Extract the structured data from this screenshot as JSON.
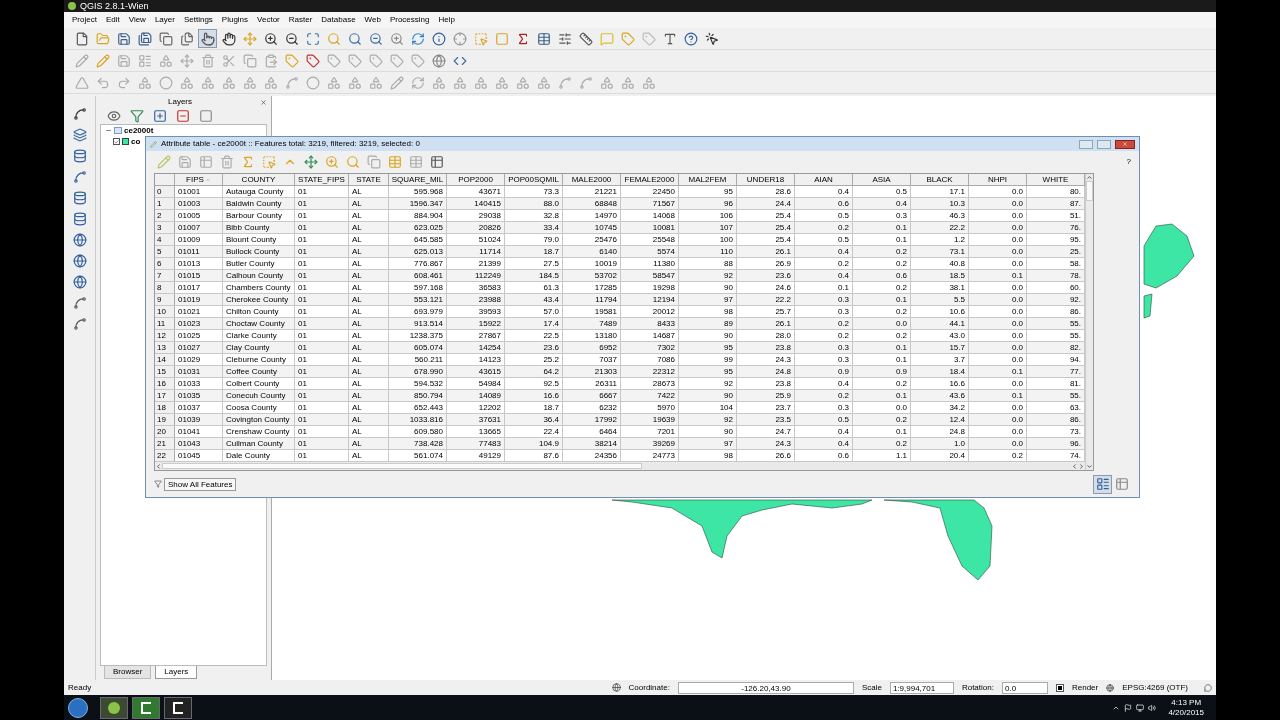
{
  "window": {
    "title": "QGIS 2.8.1-Wien"
  },
  "menu": [
    "Project",
    "Edit",
    "View",
    "Layer",
    "Settings",
    "Plugins",
    "Vector",
    "Raster",
    "Database",
    "Web",
    "Processing",
    "Help"
  ],
  "layers_panel": {
    "title": "Layers",
    "tree": [
      {
        "label": "ce2000t",
        "expanded": true,
        "children": [
          {
            "label": "co",
            "checked": true
          }
        ]
      }
    ],
    "tabs": [
      {
        "label": "Browser",
        "selected": false
      },
      {
        "label": "Layers",
        "selected": true
      }
    ]
  },
  "attribute_table": {
    "title": "Attribute table - ce2000t :: Features total: 3219, filtered: 3219, selected: 0",
    "help": "?",
    "columns": [
      {
        "name": "FIPS",
        "sorted": true
      },
      {
        "name": "COUNTY",
        "sorted": false
      },
      {
        "name": "STATE_FIPS",
        "sorted": false
      },
      {
        "name": "STATE",
        "sorted": false
      },
      {
        "name": "SQUARE_MIL",
        "sorted": false
      },
      {
        "name": "POP2000",
        "sorted": false
      },
      {
        "name": "POP00SQMIL",
        "sorted": false
      },
      {
        "name": "MALE2000",
        "sorted": false
      },
      {
        "name": "FEMALE2000",
        "sorted": false
      },
      {
        "name": "MAL2FEM",
        "sorted": false
      },
      {
        "name": "UNDER18",
        "sorted": false
      },
      {
        "name": "AIAN",
        "sorted": false
      },
      {
        "name": "ASIA",
        "sorted": false
      },
      {
        "name": "BLACK",
        "sorted": false
      },
      {
        "name": "NHPI",
        "sorted": false
      },
      {
        "name": "WHITE",
        "sorted": false
      }
    ],
    "rows": [
      {
        "index": "0",
        "cells": [
          "01001",
          "Autauga County",
          "01",
          "AL",
          "595.968",
          "43671",
          "73.3",
          "21221",
          "22450",
          "95",
          "28.6",
          "0.4",
          "0.5",
          "17.1",
          "0.0",
          "80."
        ]
      },
      {
        "index": "1",
        "cells": [
          "01003",
          "Baldwin County",
          "01",
          "AL",
          "1596.347",
          "140415",
          "88.0",
          "68848",
          "71567",
          "96",
          "24.4",
          "0.6",
          "0.4",
          "10.3",
          "0.0",
          "87."
        ]
      },
      {
        "index": "2",
        "cells": [
          "01005",
          "Barbour County",
          "01",
          "AL",
          "884.904",
          "29038",
          "32.8",
          "14970",
          "14068",
          "106",
          "25.4",
          "0.5",
          "0.3",
          "46.3",
          "0.0",
          "51."
        ]
      },
      {
        "index": "3",
        "cells": [
          "01007",
          "Bibb County",
          "01",
          "AL",
          "623.025",
          "20826",
          "33.4",
          "10745",
          "10081",
          "107",
          "25.4",
          "0.2",
          "0.1",
          "22.2",
          "0.0",
          "76."
        ]
      },
      {
        "index": "4",
        "cells": [
          "01009",
          "Blount County",
          "01",
          "AL",
          "645.585",
          "51024",
          "79.0",
          "25476",
          "25548",
          "100",
          "25.4",
          "0.5",
          "0.1",
          "1.2",
          "0.0",
          "95."
        ]
      },
      {
        "index": "5",
        "cells": [
          "01011",
          "Bullock County",
          "01",
          "AL",
          "625.013",
          "11714",
          "18.7",
          "6140",
          "5574",
          "110",
          "26.1",
          "0.4",
          "0.2",
          "73.1",
          "0.0",
          "25."
        ]
      },
      {
        "index": "6",
        "cells": [
          "01013",
          "Butler County",
          "01",
          "AL",
          "776.867",
          "21399",
          "27.5",
          "10019",
          "11380",
          "88",
          "26.9",
          "0.2",
          "0.2",
          "40.8",
          "0.0",
          "58."
        ]
      },
      {
        "index": "7",
        "cells": [
          "01015",
          "Calhoun County",
          "01",
          "AL",
          "608.461",
          "112249",
          "184.5",
          "53702",
          "58547",
          "92",
          "23.6",
          "0.4",
          "0.6",
          "18.5",
          "0.1",
          "78."
        ]
      },
      {
        "index": "8",
        "cells": [
          "01017",
          "Chambers County",
          "01",
          "AL",
          "597.168",
          "36583",
          "61.3",
          "17285",
          "19298",
          "90",
          "24.6",
          "0.1",
          "0.2",
          "38.1",
          "0.0",
          "60."
        ]
      },
      {
        "index": "9",
        "cells": [
          "01019",
          "Cherokee County",
          "01",
          "AL",
          "553.121",
          "23988",
          "43.4",
          "11794",
          "12194",
          "97",
          "22.2",
          "0.3",
          "0.1",
          "5.5",
          "0.0",
          "92."
        ]
      },
      {
        "index": "10",
        "cells": [
          "01021",
          "Chilton County",
          "01",
          "AL",
          "693.979",
          "39593",
          "57.0",
          "19581",
          "20012",
          "98",
          "25.7",
          "0.3",
          "0.2",
          "10.6",
          "0.0",
          "86."
        ]
      },
      {
        "index": "11",
        "cells": [
          "01023",
          "Choctaw County",
          "01",
          "AL",
          "913.514",
          "15922",
          "17.4",
          "7489",
          "8433",
          "89",
          "26.1",
          "0.2",
          "0.0",
          "44.1",
          "0.0",
          "55."
        ]
      },
      {
        "index": "12",
        "cells": [
          "01025",
          "Clarke County",
          "01",
          "AL",
          "1238.375",
          "27867",
          "22.5",
          "13180",
          "14687",
          "90",
          "28.0",
          "0.2",
          "0.2",
          "43.0",
          "0.0",
          "55."
        ]
      },
      {
        "index": "13",
        "cells": [
          "01027",
          "Clay County",
          "01",
          "AL",
          "605.074",
          "14254",
          "23.6",
          "6952",
          "7302",
          "95",
          "23.8",
          "0.3",
          "0.1",
          "15.7",
          "0.0",
          "82."
        ]
      },
      {
        "index": "14",
        "cells": [
          "01029",
          "Cleburne County",
          "01",
          "AL",
          "560.211",
          "14123",
          "25.2",
          "7037",
          "7086",
          "99",
          "24.3",
          "0.3",
          "0.1",
          "3.7",
          "0.0",
          "94."
        ]
      },
      {
        "index": "15",
        "cells": [
          "01031",
          "Coffee County",
          "01",
          "AL",
          "678.990",
          "43615",
          "64.2",
          "21303",
          "22312",
          "95",
          "24.8",
          "0.9",
          "0.9",
          "18.4",
          "0.1",
          "77."
        ]
      },
      {
        "index": "16",
        "cells": [
          "01033",
          "Colbert County",
          "01",
          "AL",
          "594.532",
          "54984",
          "92.5",
          "26311",
          "28673",
          "92",
          "23.8",
          "0.4",
          "0.2",
          "16.6",
          "0.0",
          "81."
        ]
      },
      {
        "index": "17",
        "cells": [
          "01035",
          "Conecuh County",
          "01",
          "AL",
          "850.794",
          "14089",
          "16.6",
          "6667",
          "7422",
          "90",
          "25.9",
          "0.2",
          "0.1",
          "43.6",
          "0.1",
          "55."
        ]
      },
      {
        "index": "18",
        "cells": [
          "01037",
          "Coosa County",
          "01",
          "AL",
          "652.443",
          "12202",
          "18.7",
          "6232",
          "5970",
          "104",
          "23.7",
          "0.3",
          "0.0",
          "34.2",
          "0.0",
          "63."
        ]
      },
      {
        "index": "19",
        "cells": [
          "01039",
          "Covington County",
          "01",
          "AL",
          "1033.816",
          "37631",
          "36.4",
          "17992",
          "19639",
          "92",
          "23.5",
          "0.5",
          "0.2",
          "12.4",
          "0.0",
          "86."
        ]
      },
      {
        "index": "20",
        "cells": [
          "01041",
          "Crenshaw County",
          "01",
          "AL",
          "609.580",
          "13665",
          "22.4",
          "6464",
          "7201",
          "90",
          "24.7",
          "0.4",
          "0.1",
          "24.8",
          "0.0",
          "73."
        ]
      },
      {
        "index": "21",
        "cells": [
          "01043",
          "Cullman County",
          "01",
          "AL",
          "738.428",
          "77483",
          "104.9",
          "38214",
          "39269",
          "97",
          "24.3",
          "0.4",
          "0.2",
          "1.0",
          "0.0",
          "96."
        ]
      },
      {
        "index": "22",
        "cells": [
          "01045",
          "Dale County",
          "01",
          "AL",
          "561.074",
          "49129",
          "87.6",
          "24356",
          "24773",
          "98",
          "26.6",
          "0.6",
          "1.1",
          "20.4",
          "0.2",
          "74."
        ]
      }
    ],
    "show_features_button": "Show All Features"
  },
  "status_bar": {
    "message": "Ready",
    "coordinate_label": "Coordinate:",
    "coordinate": "-126.20,43.90",
    "scale_label": "Scale",
    "scale": "1:9,994,701",
    "rotation_label": "Rotation:",
    "rotation": "0.0",
    "render": {
      "label": "Render",
      "checked": true
    },
    "crs": "EPSG:4269 (OTF)"
  },
  "taskbar": {
    "time": "4:13 PM",
    "date": "4/20/2015"
  }
}
